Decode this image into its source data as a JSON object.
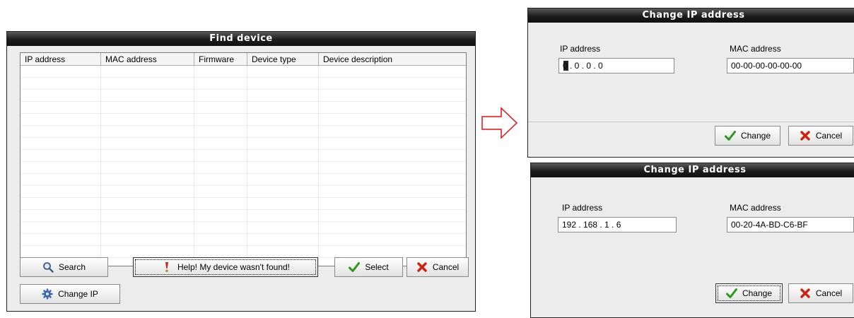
{
  "find_device": {
    "title": "Find device",
    "columns": [
      "IP address",
      "MAC address",
      "Firmware",
      "Device type",
      "Device description"
    ],
    "buttons": {
      "search": "Search",
      "help": "Help! My device wasn't found!",
      "select": "Select",
      "cancel": "Cancel",
      "change_ip": "Change IP"
    }
  },
  "dialog_empty": {
    "title": "Change IP address",
    "ip_label": "IP address",
    "ip_value": "0 . 0 . 0 . 0",
    "mac_label": "MAC address",
    "mac_value": "00-00-00-00-00-00",
    "change": "Change",
    "cancel": "Cancel"
  },
  "dialog_filled": {
    "title": "Change IP address",
    "ip_label": "IP address",
    "ip_value": "192 . 168 . 1 . 6",
    "mac_label": "MAC address",
    "mac_value": "00-20-4A-BD-C6-BF",
    "change": "Change",
    "cancel": "Cancel"
  },
  "icons": {
    "search": "magnifier-icon",
    "help": "exclamation-icon",
    "select": "checkmark-icon",
    "cancel": "red-x-icon",
    "change_ip": "gear-icon",
    "arrow": "right-arrow-icon"
  },
  "colors": {
    "title_bar": "#1c1c1c",
    "check_green": "#2a9a1a",
    "cancel_red": "#d02010",
    "arrow_red": "#e01010"
  }
}
